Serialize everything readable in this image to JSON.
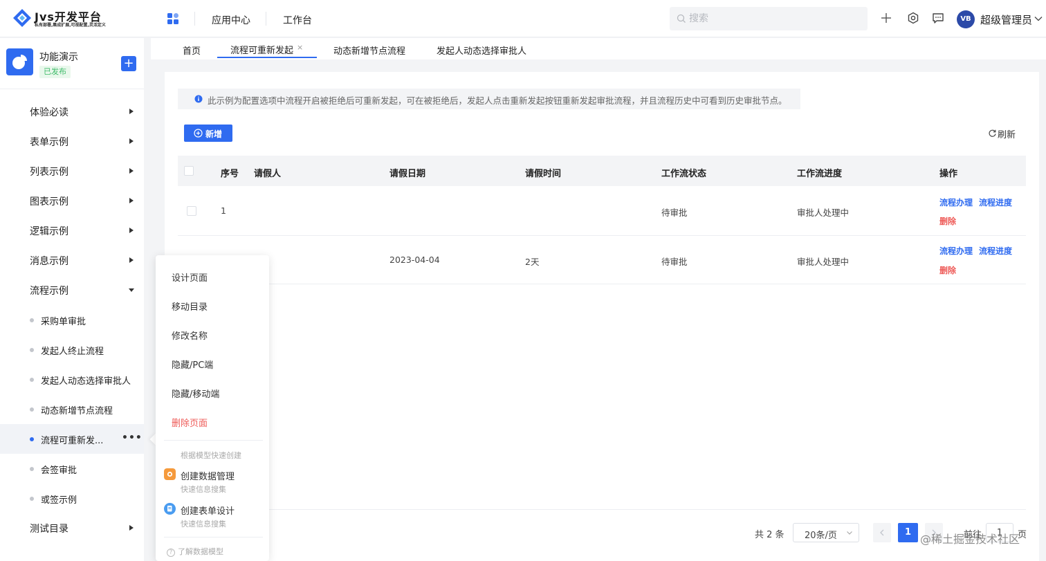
{
  "header": {
    "logo_title": "Jvs开发平台",
    "logo_subtitle": "私有部署,集成扩展,可视配置,灵活定义",
    "nav": [
      "应用中心",
      "工作台"
    ],
    "search_placeholder": "搜索",
    "user_initials": "VB",
    "user_name": "超级管理员",
    "icons": [
      "apps-grid-icon",
      "plus-icon",
      "gear-icon",
      "message-icon",
      "chevron-down-icon"
    ]
  },
  "sidebar": {
    "app_name": "功能演示",
    "app_status": "已发布",
    "add_label": "+",
    "menu_top": [
      {
        "label": "体验必读",
        "expanded": false
      },
      {
        "label": "表单示例",
        "expanded": false
      },
      {
        "label": "列表示例",
        "expanded": false
      },
      {
        "label": "图表示例",
        "expanded": false
      },
      {
        "label": "逻辑示例",
        "expanded": false
      },
      {
        "label": "消息示例",
        "expanded": false
      },
      {
        "label": "流程示例",
        "expanded": true
      }
    ],
    "sub_items": [
      {
        "label": "采购单审批",
        "active": false
      },
      {
        "label": "发起人终止流程",
        "active": false
      },
      {
        "label": "发起人动态选择审批人",
        "active": false
      },
      {
        "label": "动态新增节点流程",
        "active": false
      },
      {
        "label": "流程可重新发...",
        "active": true
      },
      {
        "label": "会签审批",
        "active": false
      },
      {
        "label": "或签示例",
        "active": false
      }
    ],
    "menu_bottom": {
      "label": "测试目录",
      "expanded": false
    },
    "more_label": "•••"
  },
  "tabs": {
    "items": [
      "首页",
      "流程可重新发起",
      "动态新增节点流程",
      "发起人动态选择审批人"
    ],
    "active_index": 1,
    "close_label": "×"
  },
  "main": {
    "notice": "此示例为配置选项中流程开启被拒绝后可重新发起，可在被拒绝后，发起人点击重新发起按钮重新发起审批流程，并且流程历史中可看到历史审批节点。",
    "new_button": "新增",
    "refresh_button": "刷新",
    "columns": [
      "序号",
      "请假人",
      "请假日期",
      "请假时间",
      "工作流状态",
      "工作流进度",
      "操作"
    ],
    "rows": [
      {
        "index": "1",
        "applicant": "",
        "date": "",
        "duration": "",
        "status": "待审批",
        "progress": "审批人处理中",
        "actions": [
          "流程办理",
          "流程进度",
          "删除"
        ]
      },
      {
        "index": "",
        "applicant": "",
        "date": "2023-04-04",
        "duration": "2天",
        "status": "待审批",
        "progress": "审批人处理中",
        "actions": [
          "流程办理",
          "流程进度",
          "删除"
        ]
      }
    ]
  },
  "pagination": {
    "total": "共 2 条",
    "page_size": "20条/页",
    "current_page": "1",
    "goto_label": "前往",
    "goto_value": "1",
    "page_suffix": "页"
  },
  "context_menu": {
    "items": [
      "设计页面",
      "移动目录",
      "修改名称",
      "隐藏/PC端",
      "隐藏/移动端"
    ],
    "danger_item": "删除页面",
    "section_hint": "根据模型快速创建",
    "quick_create": [
      {
        "title": "创建数据管理",
        "subtitle": "快速信息搜集",
        "icon": "data-manage-icon",
        "color": "#f59a3c"
      },
      {
        "title": "创建表单设计",
        "subtitle": "快速信息搜集",
        "icon": "form-design-icon",
        "color": "#4a9cf0"
      }
    ],
    "footer": "了解数据模型"
  },
  "credit": "@稀土掘金技术社区",
  "colors": {
    "accent": "#2f6bf0",
    "danger": "#ee5a57",
    "published": "#3fbb6a"
  }
}
